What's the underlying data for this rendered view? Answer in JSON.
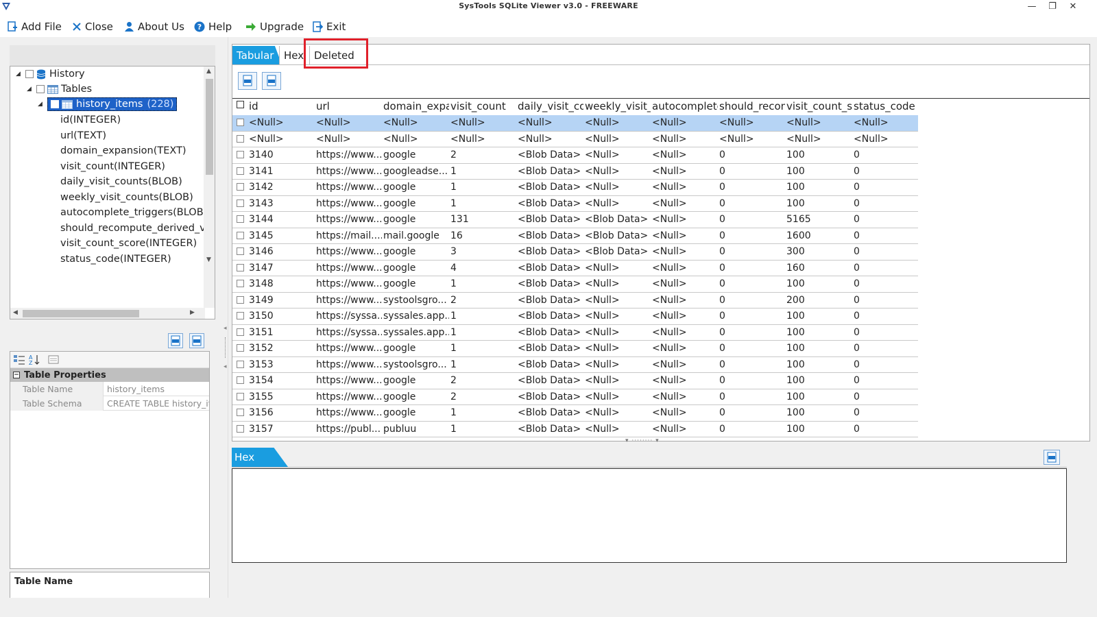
{
  "window": {
    "title": "SysTools SQLite Viewer  v3.0 - FREEWARE",
    "minimize": "—",
    "restore": "❐",
    "close": "✕"
  },
  "toolbar": {
    "add_file": "Add File",
    "close": "Close",
    "about_us": "About Us",
    "help": "Help",
    "upgrade": "Upgrade",
    "exit": "Exit"
  },
  "tree": {
    "root": "History",
    "tables": "Tables",
    "table_name": "history_items",
    "table_count": "(228)",
    "columns": [
      "id(INTEGER)",
      "url(TEXT)",
      "domain_expansion(TEXT)",
      "visit_count(INTEGER)",
      "daily_visit_counts(BLOB)",
      "weekly_visit_counts(BLOB)",
      "autocomplete_triggers(BLOB)",
      "should_recompute_derived_visi",
      "visit_count_score(INTEGER)",
      "status_code(INTEGER)"
    ]
  },
  "properties": {
    "category": "Table Properties",
    "rows": [
      {
        "key": "Table Name",
        "value": "history_items"
      },
      {
        "key": "Table Schema",
        "value": "CREATE TABLE history_item"
      }
    ],
    "description_title": "Table Name"
  },
  "tabs": [
    "Tabular",
    "Hex",
    "Deleted"
  ],
  "grid": {
    "columns": [
      "id",
      "url",
      "domain_expai",
      "visit_count",
      "daily_visit_cou",
      "weekly_visit_c",
      "autocomplete",
      "should_recom",
      "visit_count_sc",
      "status_code"
    ],
    "rows": [
      [
        "<Null>",
        "<Null>",
        "<Null>",
        "<Null>",
        "<Null>",
        "<Null>",
        "<Null>",
        "<Null>",
        "<Null>",
        "<Null>"
      ],
      [
        "<Null>",
        "<Null>",
        "<Null>",
        "<Null>",
        "<Null>",
        "<Null>",
        "<Null>",
        "<Null>",
        "<Null>",
        "<Null>"
      ],
      [
        "3140",
        "https://www...",
        "google",
        "2",
        "<Blob Data>",
        "<Null>",
        "<Null>",
        "0",
        "100",
        "0"
      ],
      [
        "3141",
        "https://www...",
        "googleadse...",
        "1",
        "<Blob Data>",
        "<Null>",
        "<Null>",
        "0",
        "100",
        "0"
      ],
      [
        "3142",
        "https://www...",
        "google",
        "1",
        "<Blob Data>",
        "<Null>",
        "<Null>",
        "0",
        "100",
        "0"
      ],
      [
        "3143",
        "https://www...",
        "google",
        "1",
        "<Blob Data>",
        "<Null>",
        "<Null>",
        "0",
        "100",
        "0"
      ],
      [
        "3144",
        "https://www...",
        "google",
        "131",
        "<Blob Data>",
        "<Blob Data>",
        "<Null>",
        "0",
        "5165",
        "0"
      ],
      [
        "3145",
        "https://mail....",
        "mail.google",
        "16",
        "<Blob Data>",
        "<Blob Data>",
        "<Null>",
        "0",
        "1600",
        "0"
      ],
      [
        "3146",
        "https://www...",
        "google",
        "3",
        "<Blob Data>",
        "<Blob Data>",
        "<Null>",
        "0",
        "300",
        "0"
      ],
      [
        "3147",
        "https://www...",
        "google",
        "4",
        "<Blob Data>",
        "<Null>",
        "<Null>",
        "0",
        "160",
        "0"
      ],
      [
        "3148",
        "https://www...",
        "google",
        "1",
        "<Blob Data>",
        "<Null>",
        "<Null>",
        "0",
        "100",
        "0"
      ],
      [
        "3149",
        "https://www...",
        "systoolsgro...",
        "2",
        "<Blob Data>",
        "<Null>",
        "<Null>",
        "0",
        "200",
        "0"
      ],
      [
        "3150",
        "https://syssa...",
        "syssales.app...",
        "1",
        "<Blob Data>",
        "<Null>",
        "<Null>",
        "0",
        "100",
        "0"
      ],
      [
        "3151",
        "https://syssa...",
        "syssales.app...",
        "1",
        "<Blob Data>",
        "<Null>",
        "<Null>",
        "0",
        "100",
        "0"
      ],
      [
        "3152",
        "https://www...",
        "google",
        "1",
        "<Blob Data>",
        "<Null>",
        "<Null>",
        "0",
        "100",
        "0"
      ],
      [
        "3153",
        "https://www...",
        "systoolsgro...",
        "1",
        "<Blob Data>",
        "<Null>",
        "<Null>",
        "0",
        "100",
        "0"
      ],
      [
        "3154",
        "https://www...",
        "google",
        "2",
        "<Blob Data>",
        "<Null>",
        "<Null>",
        "0",
        "100",
        "0"
      ],
      [
        "3155",
        "https://www...",
        "google",
        "2",
        "<Blob Data>",
        "<Null>",
        "<Null>",
        "0",
        "100",
        "0"
      ],
      [
        "3156",
        "https://www...",
        "google",
        "1",
        "<Blob Data>",
        "<Null>",
        "<Null>",
        "0",
        "100",
        "0"
      ],
      [
        "3157",
        "https://publ...",
        "publuu",
        "1",
        "<Blob Data>",
        "<Null>",
        "<Null>",
        "0",
        "100",
        "0"
      ]
    ]
  },
  "hex_panel": {
    "tab": "Hex"
  },
  "colors": {
    "accent": "#1a9de0",
    "selection": "#1e62c8",
    "row_selected": "#b6d4f5",
    "highlight_box": "#e0202a"
  }
}
